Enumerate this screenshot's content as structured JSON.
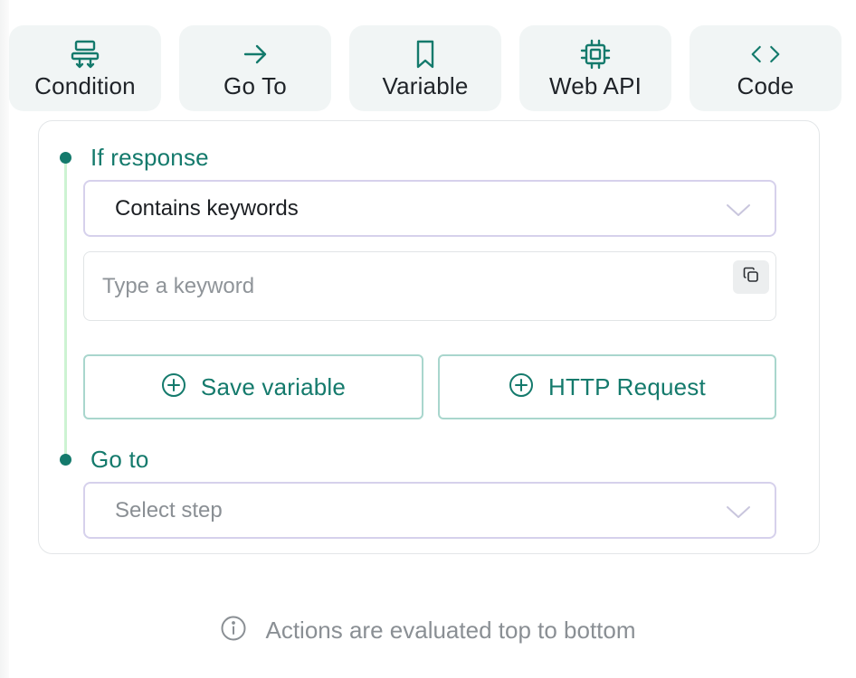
{
  "toolbar": {
    "items": [
      {
        "label": "Condition",
        "icon": "condition-icon"
      },
      {
        "label": "Go To",
        "icon": "arrow-right-icon"
      },
      {
        "label": "Variable",
        "icon": "bookmark-icon"
      },
      {
        "label": "Web API",
        "icon": "chip-icon"
      },
      {
        "label": "Code",
        "icon": "code-icon"
      }
    ]
  },
  "condition": {
    "title": "If response",
    "operator_value": "Contains keywords",
    "keyword_placeholder": "Type a keyword",
    "keyword_value": "",
    "buttons": {
      "save_variable": "Save variable",
      "http_request": "HTTP Request"
    }
  },
  "goto": {
    "title": "Go to",
    "step_placeholder": "Select step"
  },
  "footer": {
    "note": "Actions are evaluated top to bottom"
  },
  "colors": {
    "accent": "#147a6c",
    "timeline": "#cdf3d2",
    "tile_bg": "#f1f5f5",
    "select_border": "#d6d1ec",
    "button_border": "#a9d6cd"
  }
}
